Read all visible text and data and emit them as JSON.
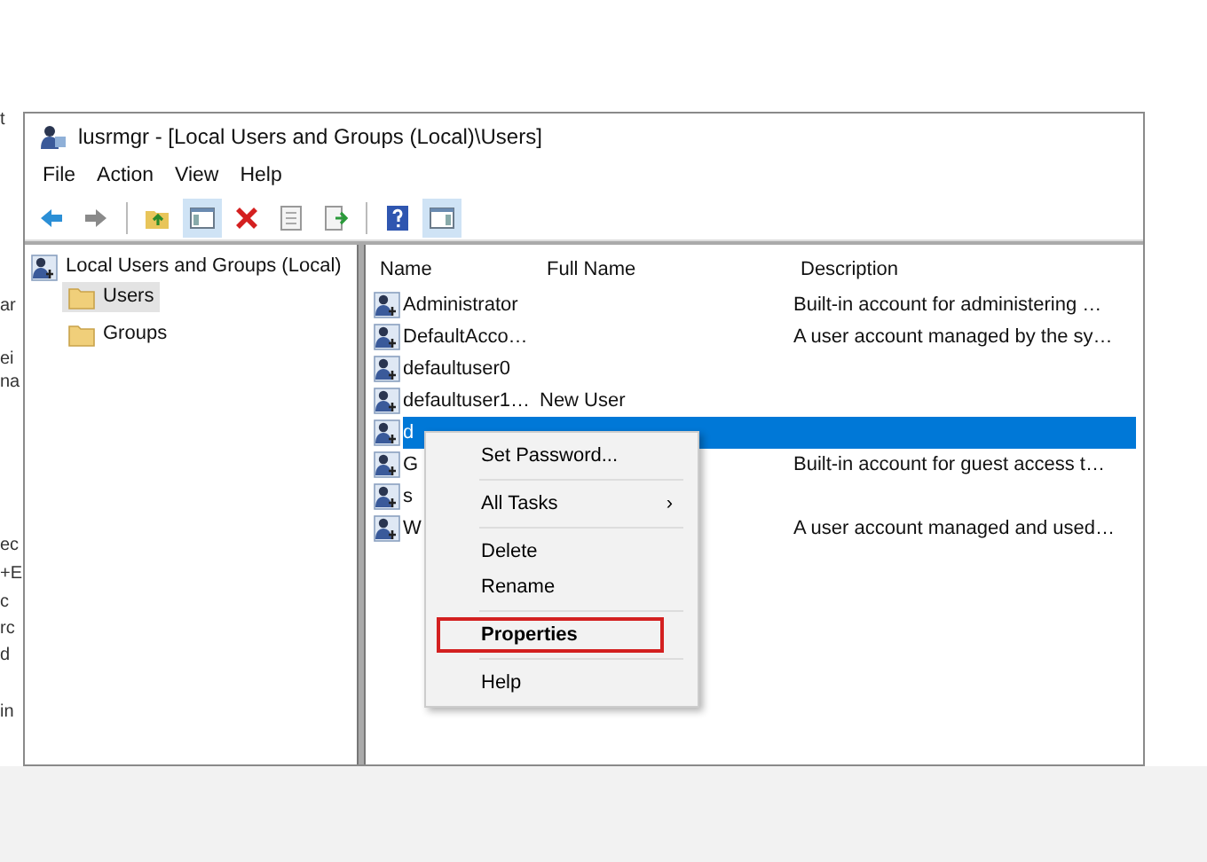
{
  "background_text": [
    "t",
    "ar",
    "ei",
    "na",
    "ec",
    "+E",
    "c",
    "rc",
    "d",
    "in"
  ],
  "window": {
    "title": "lusrmgr - [Local Users and Groups (Local)\\Users]"
  },
  "menu": [
    "File",
    "Action",
    "View",
    "Help"
  ],
  "toolbar": [
    {
      "kind": "back",
      "selected": false
    },
    {
      "kind": "forward",
      "selected": false
    },
    {
      "kind": "sep"
    },
    {
      "kind": "up",
      "selected": false
    },
    {
      "kind": "tree",
      "selected": true
    },
    {
      "kind": "delete",
      "selected": false
    },
    {
      "kind": "props",
      "selected": false
    },
    {
      "kind": "export",
      "selected": false
    },
    {
      "kind": "sep"
    },
    {
      "kind": "help",
      "selected": false
    },
    {
      "kind": "pane",
      "selected": true
    }
  ],
  "tree": {
    "label": "Local Users and Groups (Local)",
    "children": [
      {
        "label": "Users",
        "selected": true
      },
      {
        "label": "Groups",
        "selected": false
      }
    ]
  },
  "table": {
    "columns": [
      "Name",
      "Full Name",
      "Description"
    ],
    "rows": [
      {
        "name": "Administrator",
        "full_name": "",
        "description": "Built-in account for administering …",
        "selected": false
      },
      {
        "name": "DefaultAcco…",
        "full_name": "",
        "description": "A user account managed by the sy…",
        "selected": false
      },
      {
        "name": "defaultuser0",
        "full_name": "",
        "description": "",
        "selected": false
      },
      {
        "name": "defaultuser1…",
        "full_name": "New User",
        "description": "",
        "selected": false
      },
      {
        "name": "d",
        "full_name": "",
        "description": "",
        "selected": true
      },
      {
        "name": "G",
        "full_name": "",
        "description": "Built-in account for guest access t…",
        "selected": false
      },
      {
        "name": "s",
        "full_name": "",
        "description": "",
        "selected": false
      },
      {
        "name": "W",
        "full_name": "",
        "description": "A user account managed and used…",
        "selected": false
      }
    ]
  },
  "context_menu": [
    {
      "kind": "item",
      "label": "Set Password...",
      "submenu": false,
      "highlighted": false
    },
    {
      "kind": "sep"
    },
    {
      "kind": "item",
      "label": "All Tasks",
      "submenu": true,
      "highlighted": false
    },
    {
      "kind": "sep"
    },
    {
      "kind": "item",
      "label": "Delete",
      "submenu": false,
      "highlighted": false
    },
    {
      "kind": "item",
      "label": "Rename",
      "submenu": false,
      "highlighted": false
    },
    {
      "kind": "sep"
    },
    {
      "kind": "item",
      "label": "Properties",
      "submenu": false,
      "highlighted": true
    },
    {
      "kind": "sep"
    },
    {
      "kind": "item",
      "label": "Help",
      "submenu": false,
      "highlighted": false
    }
  ],
  "submenu_mark": "›"
}
